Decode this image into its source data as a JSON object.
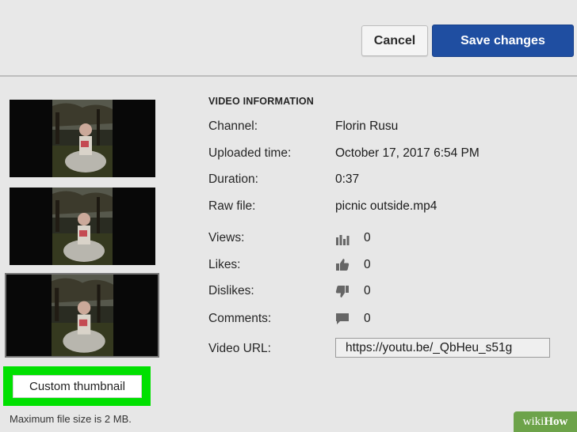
{
  "header": {
    "cancel_label": "Cancel",
    "save_label": "Save changes"
  },
  "colors": {
    "save_button": "#1f4ea1",
    "highlight": "#00e000",
    "background": "#e7e7e7"
  },
  "thumbnails": [
    {
      "name": "thumbnail-option-1",
      "selected": false
    },
    {
      "name": "thumbnail-option-2",
      "selected": false
    },
    {
      "name": "thumbnail-option-3",
      "selected": true
    }
  ],
  "custom_thumbnail": {
    "label": "Custom thumbnail",
    "note": "Maximum file size is 2 MB."
  },
  "video_info": {
    "title": "VIDEO INFORMATION",
    "channel_label": "Channel:",
    "channel": "Florin Rusu",
    "uploaded_label": "Uploaded time:",
    "uploaded": "October 17, 2017 6:54 PM",
    "duration_label": "Duration:",
    "duration": "0:37",
    "raw_label": "Raw file:",
    "raw_file": "picnic outside.mp4",
    "views_label": "Views:",
    "views": "0",
    "views_icon": "bar-chart-icon",
    "likes_label": "Likes:",
    "likes": "0",
    "likes_icon": "thumbs-up-icon",
    "dislikes_label": "Dislikes:",
    "dislikes": "0",
    "dislikes_icon": "thumbs-down-icon",
    "comments_label": "Comments:",
    "comments": "0",
    "comments_icon": "comment-icon",
    "url_label": "Video URL:",
    "url": "https://youtu.be/_QbHeu_s51g"
  },
  "watermark": {
    "prefix": "wiki",
    "suffix": "How"
  }
}
